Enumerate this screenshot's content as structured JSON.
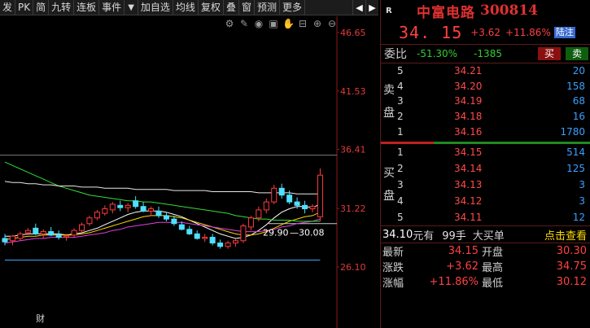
{
  "toolbar": {
    "buttons": [
      "发",
      "PK",
      "简",
      "九转",
      "连板",
      "事件",
      "加自选",
      "均线",
      "复权",
      "叠",
      "窗",
      "预测",
      "更多"
    ],
    "nav_prev": "◀",
    "nav_next": "▶"
  },
  "chart_icons": [
    "gear-icon",
    "draw-icon",
    "eye-icon",
    "camera-icon",
    "hand-icon",
    "minus-icon",
    "zoom-in-icon",
    "zoom-out-icon"
  ],
  "chart_data": {
    "type": "candlestick",
    "y_axis_labels": [
      "46.65",
      "41.53",
      "36.41",
      "31.22",
      "26.10"
    ],
    "ylim": [
      26.1,
      46.65
    ],
    "annotations": [
      "29.90",
      "30.08"
    ],
    "reference_lines": {
      "high": 35.9,
      "low": 26.1
    },
    "candles": [
      {
        "o": 28.6,
        "h": 29.0,
        "l": 28.0,
        "c": 28.3
      },
      {
        "o": 28.4,
        "h": 28.9,
        "l": 28.0,
        "c": 28.8
      },
      {
        "o": 28.6,
        "h": 29.2,
        "l": 28.4,
        "c": 29.0
      },
      {
        "o": 29.1,
        "h": 29.5,
        "l": 28.9,
        "c": 29.3
      },
      {
        "o": 29.5,
        "h": 29.9,
        "l": 28.9,
        "c": 29.0
      },
      {
        "o": 29.0,
        "h": 29.4,
        "l": 28.6,
        "c": 29.2
      },
      {
        "o": 29.2,
        "h": 29.6,
        "l": 28.8,
        "c": 28.9
      },
      {
        "o": 28.9,
        "h": 29.3,
        "l": 28.5,
        "c": 28.7
      },
      {
        "o": 28.7,
        "h": 29.0,
        "l": 28.4,
        "c": 28.8
      },
      {
        "o": 28.9,
        "h": 29.5,
        "l": 28.7,
        "c": 29.3
      },
      {
        "o": 29.3,
        "h": 30.0,
        "l": 29.1,
        "c": 29.8
      },
      {
        "o": 29.9,
        "h": 30.6,
        "l": 29.7,
        "c": 30.4
      },
      {
        "o": 30.4,
        "h": 31.1,
        "l": 30.2,
        "c": 30.9
      },
      {
        "o": 30.8,
        "h": 31.5,
        "l": 30.6,
        "c": 31.2
      },
      {
        "o": 31.1,
        "h": 31.8,
        "l": 30.8,
        "c": 31.6
      },
      {
        "o": 31.5,
        "h": 31.9,
        "l": 31.0,
        "c": 31.3
      },
      {
        "o": 31.3,
        "h": 31.7,
        "l": 30.9,
        "c": 31.5
      },
      {
        "o": 31.9,
        "h": 32.3,
        "l": 31.2,
        "c": 31.4
      },
      {
        "o": 31.4,
        "h": 31.8,
        "l": 30.9,
        "c": 31.0
      },
      {
        "o": 31.0,
        "h": 31.4,
        "l": 30.6,
        "c": 31.2
      },
      {
        "o": 31.0,
        "h": 31.4,
        "l": 30.4,
        "c": 30.6
      },
      {
        "o": 30.6,
        "h": 30.9,
        "l": 30.1,
        "c": 30.3
      },
      {
        "o": 30.3,
        "h": 30.6,
        "l": 29.7,
        "c": 29.9
      },
      {
        "o": 29.8,
        "h": 30.1,
        "l": 29.3,
        "c": 29.4
      },
      {
        "o": 29.4,
        "h": 29.7,
        "l": 28.9,
        "c": 29.0
      },
      {
        "o": 29.0,
        "h": 29.3,
        "l": 28.5,
        "c": 28.6
      },
      {
        "o": 28.6,
        "h": 29.0,
        "l": 28.3,
        "c": 28.7
      },
      {
        "o": 28.7,
        "h": 29.0,
        "l": 28.0,
        "c": 28.2
      },
      {
        "o": 28.2,
        "h": 28.5,
        "l": 27.7,
        "c": 27.9
      },
      {
        "o": 27.9,
        "h": 28.4,
        "l": 27.7,
        "c": 28.2
      },
      {
        "o": 28.2,
        "h": 28.6,
        "l": 27.9,
        "c": 28.4
      },
      {
        "o": 28.4,
        "h": 29.9,
        "l": 28.2,
        "c": 29.7
      },
      {
        "o": 29.6,
        "h": 30.6,
        "l": 29.3,
        "c": 30.4
      },
      {
        "o": 30.4,
        "h": 31.4,
        "l": 30.1,
        "c": 31.1
      },
      {
        "o": 31.1,
        "h": 32.1,
        "l": 30.8,
        "c": 31.8
      },
      {
        "o": 31.8,
        "h": 33.3,
        "l": 31.6,
        "c": 33.0
      },
      {
        "o": 33.0,
        "h": 33.4,
        "l": 32.1,
        "c": 32.4
      },
      {
        "o": 32.4,
        "h": 32.8,
        "l": 31.6,
        "c": 31.8
      },
      {
        "o": 31.8,
        "h": 32.2,
        "l": 31.2,
        "c": 31.5
      },
      {
        "o": 31.5,
        "h": 31.9,
        "l": 30.8,
        "c": 31.2
      },
      {
        "o": 31.2,
        "h": 31.6,
        "l": 30.9,
        "c": 31.4
      },
      {
        "o": 30.5,
        "h": 34.75,
        "l": 30.12,
        "c": 34.15
      }
    ],
    "ma_series": [
      {
        "color": "#ffffff",
        "values": [
          28.8,
          28.8,
          28.9,
          29.0,
          29.0,
          29.0,
          29.0,
          29.0,
          28.9,
          29.0,
          29.1,
          29.3,
          29.5,
          29.8,
          30.1,
          30.4,
          30.7,
          30.9,
          31.0,
          31.0,
          31.0,
          30.9,
          30.7,
          30.5,
          30.2,
          29.9,
          29.6,
          29.3,
          29.0,
          28.8,
          28.6,
          28.7,
          28.9,
          29.3,
          29.8,
          30.4,
          30.9,
          31.2,
          31.4,
          31.4,
          31.3,
          31.6
        ]
      },
      {
        "color": "#ffd400",
        "values": [
          28.5,
          28.6,
          28.7,
          28.8,
          28.8,
          28.9,
          28.9,
          28.9,
          28.9,
          28.9,
          29.0,
          29.1,
          29.3,
          29.5,
          29.7,
          29.9,
          30.1,
          30.3,
          30.5,
          30.6,
          30.6,
          30.6,
          30.5,
          30.4,
          30.2,
          30.0,
          29.8,
          29.6,
          29.4,
          29.2,
          29.0,
          28.9,
          28.9,
          29.0,
          29.2,
          29.5,
          29.8,
          30.1,
          30.3,
          30.5,
          30.6,
          30.9
        ]
      },
      {
        "color": "#e040e0",
        "values": [
          28.2,
          28.3,
          28.4,
          28.5,
          28.6,
          28.6,
          28.7,
          28.7,
          28.7,
          28.7,
          28.8,
          28.9,
          29.0,
          29.1,
          29.3,
          29.4,
          29.6,
          29.7,
          29.8,
          29.9,
          30.0,
          30.0,
          30.0,
          30.0,
          29.9,
          29.8,
          29.7,
          29.6,
          29.5,
          29.4,
          29.3,
          29.2,
          29.2,
          29.2,
          29.3,
          29.4,
          29.6,
          29.7,
          29.9,
          30.0,
          30.1,
          30.3
        ]
      },
      {
        "color": "#33dd33",
        "values": [
          35.3,
          35.0,
          34.7,
          34.4,
          34.1,
          33.8,
          33.5,
          33.2,
          33.0,
          32.8,
          32.6,
          32.4,
          32.3,
          32.2,
          32.1,
          32.0,
          31.9,
          31.9,
          31.8,
          31.8,
          31.7,
          31.6,
          31.5,
          31.4,
          31.3,
          31.2,
          31.1,
          31.0,
          30.9,
          30.8,
          30.6,
          30.5,
          30.4,
          30.3,
          30.3,
          30.2,
          30.2,
          30.2,
          30.1,
          30.1,
          30.1,
          30.1
        ]
      },
      {
        "color": "#e8e8e8",
        "values": [
          33.6,
          33.5,
          33.5,
          33.4,
          33.4,
          33.3,
          33.3,
          33.2,
          33.2,
          33.2,
          33.1,
          33.1,
          33.1,
          33.0,
          33.0,
          33.0,
          33.0,
          32.9,
          32.9,
          32.9,
          32.9,
          32.9,
          32.8,
          32.8,
          32.8,
          32.8,
          32.8,
          32.7,
          32.7,
          32.7,
          32.7,
          32.7,
          32.7,
          32.6,
          32.6,
          32.6,
          32.6,
          32.6,
          32.5,
          32.5,
          32.5,
          32.5
        ]
      },
      {
        "color": "#40b0ff",
        "values": [
          26.7,
          26.7,
          26.7,
          26.7,
          26.7,
          26.7,
          26.7,
          26.7,
          26.7,
          26.7,
          26.7,
          26.7,
          26.7,
          26.7,
          26.7,
          26.7,
          26.7,
          26.7,
          26.7,
          26.7,
          26.7,
          26.7,
          26.7,
          26.7,
          26.7,
          26.7,
          26.7,
          26.7,
          26.7,
          26.7,
          26.7,
          26.7,
          26.7,
          26.7,
          26.7,
          26.7,
          26.7,
          26.7,
          26.7,
          26.7,
          26.7,
          26.7
        ]
      }
    ]
  },
  "fin_mark": "财",
  "panel": {
    "r_label": "R",
    "name": "中富电路",
    "code": "300814",
    "last": "34. 15",
    "change": "+3.62",
    "pct": "+11.86%",
    "badge": "陆",
    "badge2": "注",
    "weibi_label": "委比",
    "weibi_pct": "-51.30%",
    "weibi_diff": "-1385",
    "buy_btn": "买",
    "sell_btn": "卖",
    "sell_side_label": [
      "卖",
      "盘"
    ],
    "buy_side_label": [
      "买",
      "盘"
    ],
    "asks": [
      {
        "lv": "5",
        "price": "34.21",
        "vol": "20"
      },
      {
        "lv": "4",
        "price": "34.20",
        "vol": "158"
      },
      {
        "lv": "3",
        "price": "34.19",
        "vol": "68"
      },
      {
        "lv": "2",
        "price": "34.18",
        "vol": "16"
      },
      {
        "lv": "1",
        "price": "34.16",
        "vol": "1780"
      }
    ],
    "bids": [
      {
        "lv": "1",
        "price": "34.15",
        "vol": "514"
      },
      {
        "lv": "2",
        "price": "34.14",
        "vol": "125"
      },
      {
        "lv": "3",
        "price": "34.13",
        "vol": "3"
      },
      {
        "lv": "4",
        "price": "34.12",
        "vol": "3"
      },
      {
        "lv": "5",
        "price": "34.11",
        "vol": "12"
      }
    ],
    "trade_price": "34.10",
    "trade_unit": "元有",
    "trade_vol": "99手",
    "trade_type": "大买单",
    "trade_link": "点击查看",
    "quotes": [
      {
        "l1": "最新",
        "v1": "34.15",
        "l2": "开盘",
        "v2": "30.30",
        "v2_color": "red"
      },
      {
        "l1": "涨跌",
        "v1": "+3.62",
        "l2": "最高",
        "v2": "34.75",
        "v2_color": "red"
      },
      {
        "l1": "涨幅",
        "v1": "+11.86%",
        "l2": "最低",
        "v2": "30.12",
        "v2_color": "red"
      }
    ]
  }
}
